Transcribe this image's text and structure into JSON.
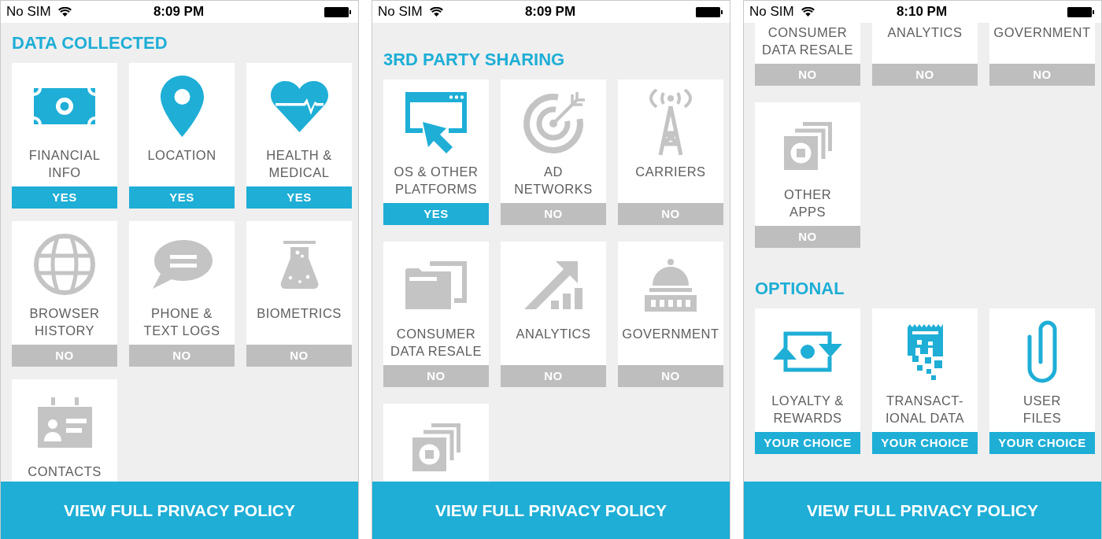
{
  "screens": [
    {
      "status_bar": {
        "carrier": "No SIM",
        "time": "8:09 PM"
      },
      "sections": [
        {
          "title": "DATA COLLECTED",
          "tiles": [
            {
              "kind": "banknote",
              "label": "FINANCIAL\nINFO",
              "answer": "YES",
              "on": true
            },
            {
              "kind": "map-pin",
              "label": "LOCATION",
              "answer": "YES",
              "on": true
            },
            {
              "kind": "heart-pulse",
              "label": "HEALTH &\nMEDICAL",
              "answer": "YES",
              "on": true
            },
            {
              "kind": "globe",
              "label": "BROWSER\nHISTORY",
              "answer": "NO",
              "on": false
            },
            {
              "kind": "speech-bubble",
              "label": "PHONE &\nTEXT LOGS",
              "answer": "NO",
              "on": false
            },
            {
              "kind": "flask",
              "label": "BIOMETRICS",
              "answer": "NO",
              "on": false
            },
            {
              "kind": "id-card",
              "label": "CONTACTS",
              "on": false
            }
          ]
        }
      ],
      "button": "VIEW FULL PRIVACY POLICY"
    },
    {
      "status_bar": {
        "carrier": "No SIM",
        "time": "8:09 PM"
      },
      "sections": [
        {
          "title": "3RD PARTY SHARING",
          "tiles": [
            {
              "kind": "window-cursor",
              "label": "OS & OTHER\nPLATFORMS",
              "answer": "YES",
              "on": true
            },
            {
              "kind": "target",
              "label": "AD\nNETWORKS",
              "answer": "NO",
              "on": false
            },
            {
              "kind": "radio-tower",
              "label": "CARRIERS",
              "answer": "NO",
              "on": false
            },
            {
              "kind": "folders",
              "label": "CONSUMER\nDATA RESALE",
              "answer": "NO",
              "on": false
            },
            {
              "kind": "rising-chart",
              "label": "ANALYTICS",
              "answer": "NO",
              "on": false
            },
            {
              "kind": "capitol",
              "label": "GOVERNMENT",
              "answer": "NO",
              "on": false
            },
            {
              "kind": "stacked-squares",
              "on": false
            }
          ]
        }
      ],
      "button": "VIEW FULL PRIVACY POLICY"
    },
    {
      "status_bar": {
        "carrier": "No SIM",
        "time": "8:10 PM"
      },
      "sections": [
        {
          "tiles": [
            {
              "label": "CONSUMER\nDATA RESALE",
              "answer": "NO",
              "on": false
            },
            {
              "label": "ANALYTICS",
              "answer": "NO",
              "on": false
            },
            {
              "label": "GOVERNMENT",
              "answer": "NO",
              "on": false
            },
            {
              "kind": "stacked-squares",
              "label": "OTHER\nAPPS",
              "answer": "NO",
              "on": false
            }
          ]
        },
        {
          "title": "OPTIONAL",
          "tiles": [
            {
              "kind": "money-exchange",
              "label": "LOYALTY &\nREWARDS",
              "answer": "YOUR CHOICE",
              "on": true
            },
            {
              "kind": "receipt",
              "label": "TRANSACT-\nIONAL DATA",
              "answer": "YOUR CHOICE",
              "on": true
            },
            {
              "kind": "paperclip",
              "label": "USER\nFILES",
              "answer": "YOUR CHOICE",
              "on": true
            }
          ]
        }
      ],
      "button": "VIEW FULL PRIVACY POLICY"
    }
  ]
}
